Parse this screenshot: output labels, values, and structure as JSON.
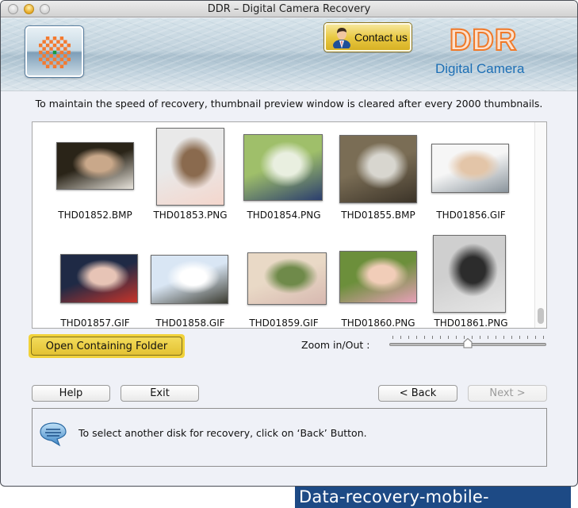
{
  "window": {
    "title": "DDR – Digital Camera Recovery"
  },
  "header": {
    "logo_icon": "ddr-app-logo-icon",
    "contact_button": {
      "label": "Contact us",
      "icon": "person-icon"
    },
    "brand": "DDR",
    "product": "Digital Camera",
    "brand_color": "#f07a2a",
    "product_color": "#1d6fb5"
  },
  "info_message": "To maintain the speed of recovery, thumbnail preview window is cleared after every 2000 thumbnails.",
  "thumbnails": [
    {
      "name": "THD01852.BMP",
      "colors": [
        "#2a2418",
        "#c9a88a",
        "#e8e4dc"
      ]
    },
    {
      "name": "THD01853.PNG",
      "colors": [
        "#e9e9e9",
        "#8a6a4e",
        "#f4d6cc"
      ]
    },
    {
      "name": "THD01854.PNG",
      "colors": [
        "#9fbf6a",
        "#e9efe0",
        "#2b3e6e"
      ]
    },
    {
      "name": "THD01855.BMP",
      "colors": [
        "#7a6d55",
        "#d8d6cf",
        "#3b3328"
      ]
    },
    {
      "name": "THD01856.GIF",
      "colors": [
        "#f6f6f6",
        "#e3c5a8",
        "#8a949c"
      ]
    },
    {
      "name": "THD01857.GIF",
      "colors": [
        "#1f2a45",
        "#e7c4b6",
        "#c8342a"
      ]
    },
    {
      "name": "THD01858.GIF",
      "colors": [
        "#d9e6f4",
        "#ffffff",
        "#3a3a2f"
      ]
    },
    {
      "name": "THD01859.GIF",
      "colors": [
        "#e9d9c6",
        "#6f8a4a",
        "#d7b8b0"
      ]
    },
    {
      "name": "THD01860.PNG",
      "colors": [
        "#6c8f3b",
        "#f1cdb8",
        "#e7a0b8"
      ]
    },
    {
      "name": "THD01861.PNG",
      "colors": [
        "#cfcfcf",
        "#2c2c2c",
        "#e6e6e6"
      ]
    }
  ],
  "actions": {
    "open_folder": "Open Containing Folder",
    "zoom_label": "Zoom in/Out :",
    "zoom_level": 0.5,
    "zoom_ticks": 20
  },
  "nav": {
    "help": "Help",
    "exit": "Exit",
    "back": "< Back",
    "next": "Next >"
  },
  "status": {
    "icon": "speech-bubble-icon",
    "text": "To select another disk for recovery, click on ‘Back’ Button."
  },
  "watermark": "Data-recovery-mobile-phone.com"
}
